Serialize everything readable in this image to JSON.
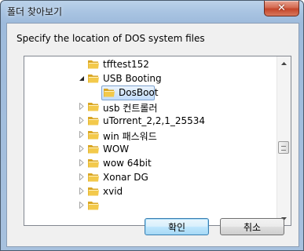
{
  "window": {
    "title": "폴더 찾아보기",
    "close_symbol": "✕"
  },
  "instruction": "Specify the location of DOS system files",
  "tree": {
    "items": [
      {
        "label": "tfftest152",
        "expander": "none",
        "selected": false
      },
      {
        "label": "USB Booting",
        "expander": "expanded",
        "selected": false
      },
      {
        "label": "DosBoot",
        "expander": "none",
        "selected": true
      },
      {
        "label": "usb 컨트롤러",
        "expander": "collapsed",
        "selected": false
      },
      {
        "label": "uTorrent_2,2,1_25534",
        "expander": "collapsed",
        "selected": false
      },
      {
        "label": "win 패스워드",
        "expander": "collapsed",
        "selected": false
      },
      {
        "label": "WOW",
        "expander": "collapsed",
        "selected": false
      },
      {
        "label": "wow 64bit",
        "expander": "collapsed",
        "selected": false
      },
      {
        "label": "Xonar DG",
        "expander": "collapsed",
        "selected": false
      },
      {
        "label": "xvid",
        "expander": "collapsed",
        "selected": false
      },
      {
        "label": "",
        "expander": "collapsed",
        "selected": false
      }
    ]
  },
  "buttons": {
    "ok": "확인",
    "cancel": "취소"
  },
  "colors": {
    "folder": "#f3c94b",
    "selection": "#c1dcfc",
    "title_gradient": "#a9c4e2",
    "close": "#c4452a"
  },
  "icons": {
    "folder": "folder-icon",
    "close": "close-icon",
    "expand": "chevron-expand-icon",
    "collapse": "chevron-collapse-icon"
  }
}
